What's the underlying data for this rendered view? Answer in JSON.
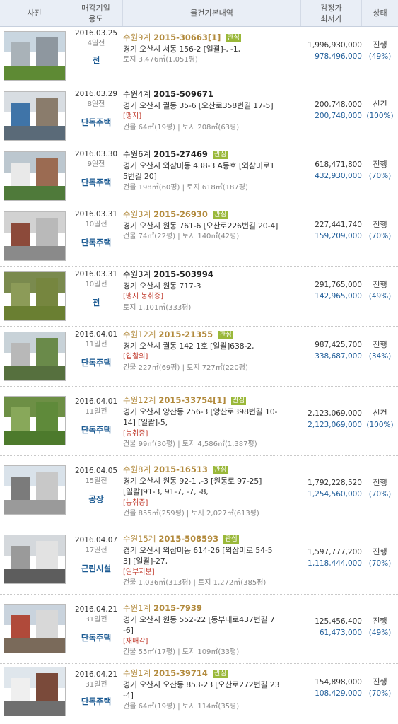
{
  "header": {
    "photo": "사진",
    "date_line1": "매각기일",
    "date_line2": "용도",
    "info": "물건기본내역",
    "price_line1": "감정가",
    "price_line2": "최저가",
    "status": "상태"
  },
  "colors": {
    "header_bg": "#e9eef6",
    "usage": "#1b5a92",
    "min_price": "#1f5d99",
    "flag": "#c0392b",
    "badge": "#9ab83a",
    "case_orange": "#b28a3c"
  },
  "rows": [
    {
      "date": "2016.03.25",
      "days": "4일전",
      "usage": "전",
      "court": "수원9계",
      "case_no": "2015-30663[1]",
      "badge": "관심",
      "case_style": "orange",
      "addr1": "경기 오산시 서동 156-2 [일괄]-, -1,",
      "addr2": "",
      "flag": "",
      "area": "토지 3,476㎡(1,051평)",
      "appraisal": "1,996,930,000",
      "minimum": "978,496,000",
      "status": "진행",
      "percent": "(49%)",
      "photo": {
        "sky": "#c9d6e0",
        "ground": "#5e8a34",
        "b1": "#a9b2b8",
        "b2": "#8e979f"
      }
    },
    {
      "date": "2016.03.29",
      "days": "8일전",
      "usage": "단독주택",
      "court": "수원4계",
      "case_no": "2015-509671",
      "badge": "",
      "case_style": "black",
      "addr1": "경기 오산시 궐동 35-6 [오산로358번길 17-5]",
      "addr2": "",
      "flag": "[맹지]",
      "area": "건물 64㎡(19평) | 토지 208㎡(63평)",
      "appraisal": "200,748,000",
      "minimum": "200,748,000",
      "status": "신건",
      "percent": "(100%)",
      "photo": {
        "sky": "#d8dde2",
        "ground": "#5a6a78",
        "b1": "#3f74a8",
        "b2": "#8a7c6c"
      }
    },
    {
      "date": "2016.03.30",
      "days": "9일전",
      "usage": "단독주택",
      "court": "수원6계",
      "case_no": "2015-27469",
      "badge": "관심",
      "case_style": "black",
      "addr1": "경기 오산시 외삼미동 438-3 A동호 [외삼미로1",
      "addr2": "5번길 20]",
      "flag": "",
      "area": "건물 198㎡(60평) | 토지 618㎡(187평)",
      "appraisal": "618,471,800",
      "minimum": "432,930,000",
      "status": "진행",
      "percent": "(70%)",
      "photo": {
        "sky": "#bcc7cf",
        "ground": "#4f7a3a",
        "b1": "#e9e9e9",
        "b2": "#9b6b52"
      }
    },
    {
      "date": "2016.03.31",
      "days": "10일전",
      "usage": "단독주택",
      "court": "수원3계",
      "case_no": "2015-26930",
      "badge": "관심",
      "case_style": "orange",
      "addr1": "경기 오산시 원동 761-6 [오산로226번길 20-4]",
      "addr2": "",
      "flag": "",
      "area": "건물 74㎡(22평) | 토지 140㎡(42평)",
      "appraisal": "227,441,740",
      "minimum": "159,209,000",
      "status": "진행",
      "percent": "(70%)",
      "photo": {
        "sky": "#d2d2d2",
        "ground": "#8a8a8a",
        "b1": "#8c4a3a",
        "b2": "#b9b9b9"
      }
    },
    {
      "date": "2016.03.31",
      "days": "10일전",
      "usage": "전",
      "court": "수원3계",
      "case_no": "2015-503994",
      "badge": "",
      "case_style": "black",
      "addr1": "경기 오산시 원동 717-3",
      "addr2": "",
      "flag": "[맹지 농취증]",
      "area": "토지 1,101㎡(333평)",
      "appraisal": "291,765,000",
      "minimum": "142,965,000",
      "status": "진행",
      "percent": "(49%)",
      "photo": {
        "sky": "#7a8a4e",
        "ground": "#6a7f32",
        "b1": "#8c9b58",
        "b2": "#76863f"
      }
    },
    {
      "date": "2016.04.01",
      "days": "11일전",
      "usage": "단독주택",
      "court": "수원12계",
      "case_no": "2015-21355",
      "badge": "관심",
      "case_style": "orange",
      "addr1": "경기 오산시 궐동 142 1호 [일괄]638-2,",
      "addr2": "",
      "flag": "[입찰외]",
      "area": "건물 227㎡(69평) | 토지 727㎡(220평)",
      "appraisal": "987,425,700",
      "minimum": "338,687,000",
      "status": "진행",
      "percent": "(34%)",
      "photo": {
        "sky": "#c8d2d8",
        "ground": "#56703e",
        "b1": "#b8b8b8",
        "b2": "#6a8a4a"
      }
    },
    {
      "date": "2016.04.01",
      "days": "11일전",
      "usage": "단독주택",
      "court": "수원12계",
      "case_no": "2015-33754[1]",
      "badge": "관심",
      "case_style": "orange",
      "addr1": "경기 오산시 양산동 256-3 [양산로398번길 10-",
      "addr2": "14] [일괄]-5,",
      "flag": "[농취증]",
      "area": "건물 99㎡(30평) | 토지 4,586㎡(1,387평)",
      "appraisal": "2,123,069,000",
      "minimum": "2,123,069,000",
      "status": "신건",
      "percent": "(100%)",
      "photo": {
        "sky": "#6d8f45",
        "ground": "#4d7a2c",
        "b1": "#88a85a",
        "b2": "#5f8a3a"
      }
    },
    {
      "date": "2016.04.05",
      "days": "15일전",
      "usage": "공장",
      "court": "수원8계",
      "case_no": "2015-16513",
      "badge": "관심",
      "case_style": "orange",
      "addr1": "경기 오산시 원동 92-1 ,-3 [원동로 97-25]",
      "addr2": "[일괄]91-3, 91-7, -7, -8,",
      "flag": "[농취증]",
      "area": "건물 855㎡(259평) | 토지 2,027㎡(613평)",
      "appraisal": "1,792,228,520",
      "minimum": "1,254,560,000",
      "status": "진행",
      "percent": "(70%)",
      "photo": {
        "sky": "#d9e2ea",
        "ground": "#9a9a9a",
        "b1": "#7b7b7b",
        "b2": "#c8c8c8"
      }
    },
    {
      "date": "2016.04.07",
      "days": "17일전",
      "usage": "근린시설",
      "court": "수원15계",
      "case_no": "2015-508593",
      "badge": "관심",
      "case_style": "orange",
      "addr1": "경기 오산시 외삼미동 614-26 [외삼미로 54-5",
      "addr2": "3] [일괄]-27,",
      "flag": "[일부지분]",
      "area": "건물 1,036㎡(313평) | 토지 1,272㎡(385평)",
      "appraisal": "1,597,777,200",
      "minimum": "1,118,444,000",
      "status": "진행",
      "percent": "(70%)",
      "photo": {
        "sky": "#d4d8dc",
        "ground": "#5d5d5d",
        "b1": "#9a9a9a",
        "b2": "#e2e2e2"
      }
    },
    {
      "date": "2016.04.21",
      "days": "31일전",
      "usage": "단독주택",
      "court": "수원1계",
      "case_no": "2015-7939",
      "badge": "",
      "case_style": "orange",
      "addr1": "경기 오산시 원동 552-22 [동부대로437번길 7",
      "addr2": "-6]",
      "flag": "[재매각]",
      "area": "건물 55㎡(17평) | 토지 109㎡(33평)",
      "appraisal": "125,456,400",
      "minimum": "61,473,000",
      "status": "진행",
      "percent": "(49%)",
      "photo": {
        "sky": "#c9d3dd",
        "ground": "#7a6a5a",
        "b1": "#b04a3a",
        "b2": "#d8d8d8"
      }
    },
    {
      "date": "2016.04.21",
      "days": "31일전",
      "usage": "단독주택",
      "court": "수원1계",
      "case_no": "2015-39714",
      "badge": "관심",
      "case_style": "orange",
      "addr1": "경기 오산시 오산동 853-23 [오산로272번길 23",
      "addr2": "-4]",
      "flag": "",
      "area": "건물 64㎡(19평) | 토지 114㎡(35평)",
      "appraisal": "154,898,000",
      "minimum": "108,429,000",
      "status": "진행",
      "percent": "(70%)",
      "photo": {
        "sky": "#dfe6ec",
        "ground": "#6f6f6f",
        "b1": "#efefef",
        "b2": "#7a4a3a"
      }
    }
  ]
}
